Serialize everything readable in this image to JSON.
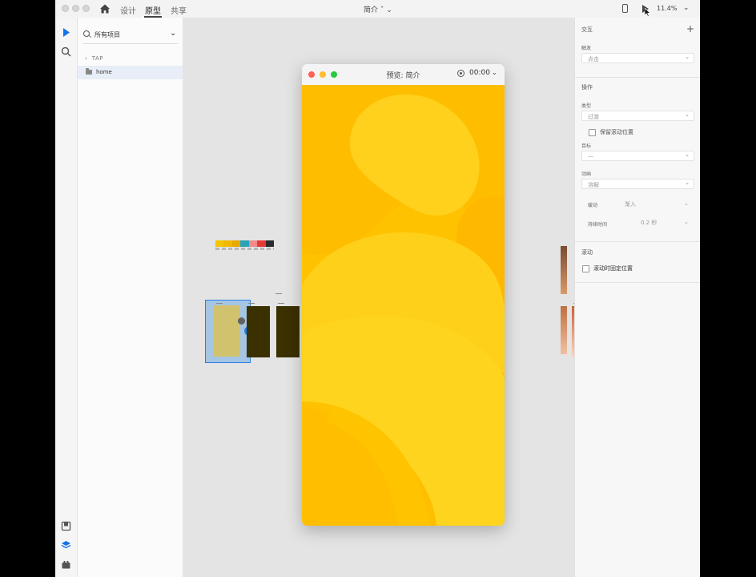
{
  "topbar": {
    "tabs": [
      {
        "label": "设计"
      },
      {
        "label": "原型"
      },
      {
        "label": "共享"
      }
    ],
    "active_tab": "原型",
    "document_title": "简介",
    "zoom": "11.4%"
  },
  "layers_panel": {
    "filter_label": "所有项目",
    "back_label": "TAP",
    "item_label": "home"
  },
  "colors": {
    "swatches": [
      "#f5c400",
      "#f2b800",
      "#e8a800",
      "#2aa3b8",
      "#f28a8a",
      "#e53935",
      "#2b2b2b"
    ],
    "preview_bg": "#ffc107",
    "accent": "#1473e6"
  },
  "preview": {
    "title": "预览: 简介",
    "timer": "00:00"
  },
  "inspector": {
    "interaction_title": "交互",
    "trigger_label": "触发",
    "trigger_value": "点击",
    "action_title": "操作",
    "type_label": "类型",
    "type_value": "过渡",
    "preserve_scroll_label": "保留滚动位置",
    "destination_label": "目标",
    "destination_value": "—",
    "animation_label": "动画",
    "animation_value": "溶解",
    "easing_label": "缓动",
    "easing_value": "渐入",
    "duration_label": "持续时间",
    "duration_value": "0.2 秒",
    "scroll_title": "滚动",
    "fixed_scroll_label": "滚动时固定位置"
  }
}
